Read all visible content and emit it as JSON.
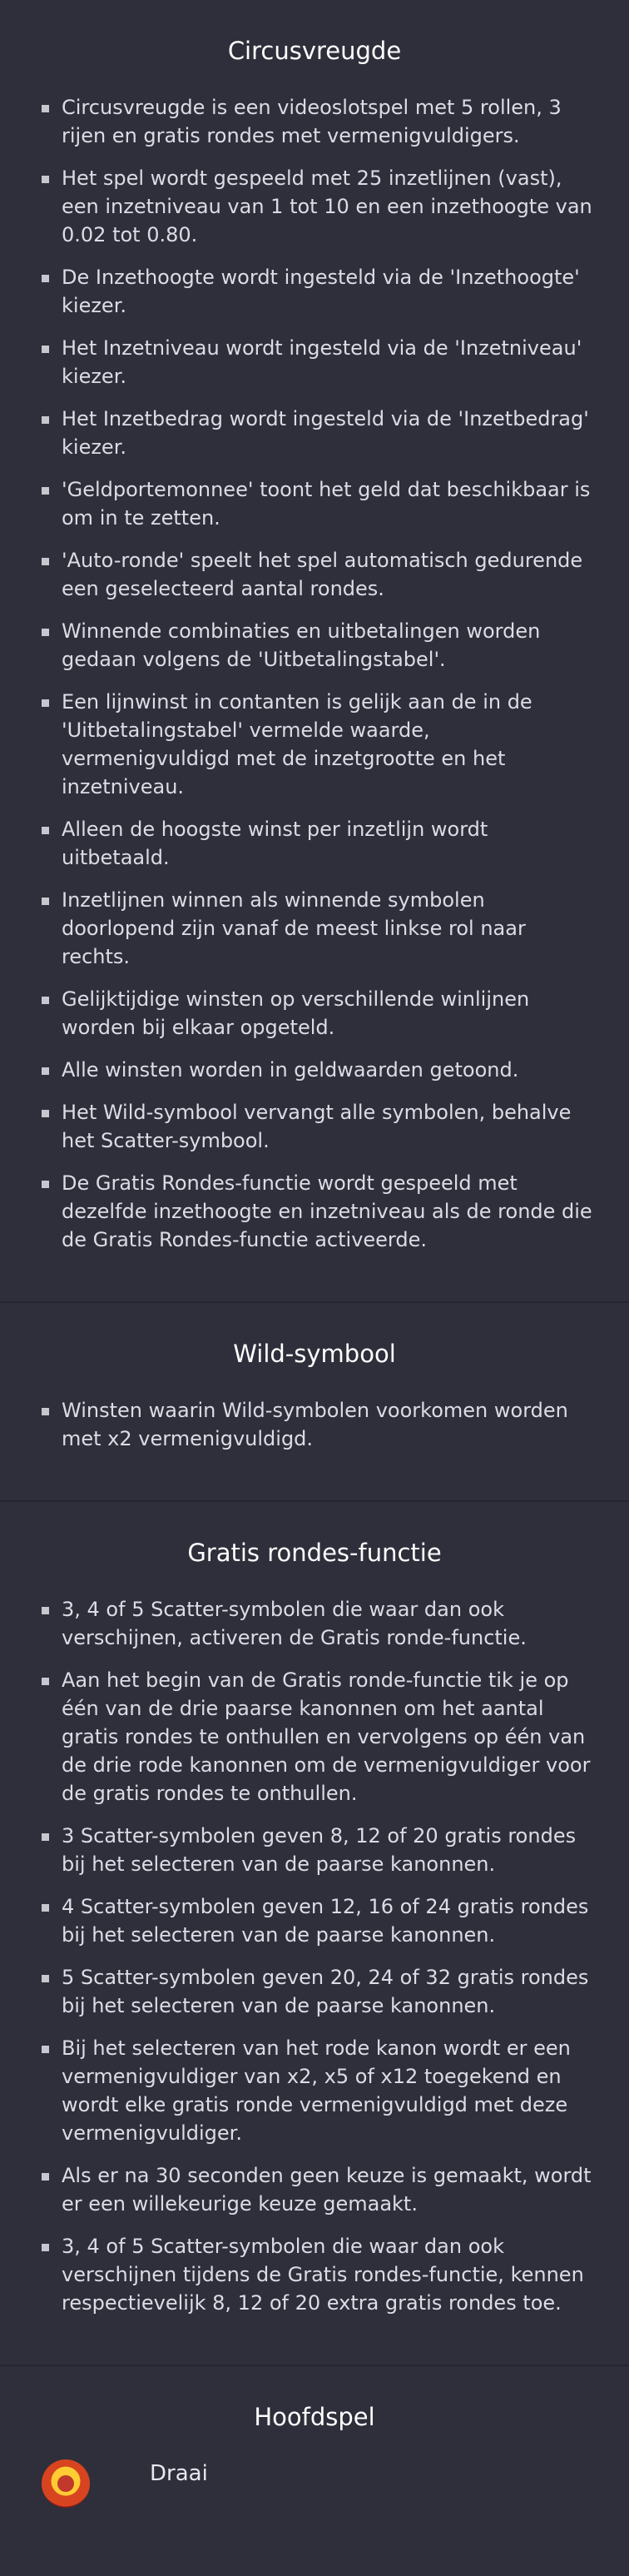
{
  "sections": [
    {
      "title": "Circusvreugde",
      "items": [
        "Circusvreugde is een videoslotspel met 5 rollen, 3 rijen en gratis rondes met vermenigvuldigers.",
        "Het spel wordt gespeeld met 25 inzetlijnen (vast), een inzetniveau van 1 tot 10 en een inzethoogte van 0.02 tot 0.80.",
        "De Inzethoogte wordt ingesteld via de 'Inzethoogte' kiezer.",
        "Het Inzetniveau wordt ingesteld via de 'Inzetniveau' kiezer.",
        "Het Inzetbedrag wordt ingesteld via de 'Inzetbedrag' kiezer.",
        "'Geldportemonnee' toont het geld dat beschikbaar is om in te zetten.",
        "'Auto-ronde' speelt het spel automatisch gedurende een geselecteerd aantal rondes.",
        "Winnende combinaties en uitbetalingen worden gedaan volgens de 'Uitbetalingstabel'.",
        "Een lijnwinst in contanten is gelijk aan de in de 'Uitbetalingstabel' vermelde waarde, vermenigvuldigd met de inzetgrootte en het inzetniveau.",
        "Alleen de hoogste winst per inzetlijn wordt uitbetaald.",
        "Inzetlijnen winnen als winnende symbolen doorlopend zijn vanaf de meest linkse rol naar rechts.",
        "Gelijktijdige winsten op verschillende winlijnen worden bij elkaar opgeteld.",
        "Alle winsten worden in geldwaarden getoond.",
        "Het Wild-symbool vervangt alle symbolen, behalve het Scatter-symbool.",
        "De Gratis Rondes-functie wordt gespeeld met dezelfde inzethoogte en inzetniveau als de ronde die de Gratis Rondes-functie activeerde."
      ]
    },
    {
      "title": "Wild-symbool",
      "items": [
        "Winsten waarin Wild-symbolen voorkomen worden met x2 vermenigvuldigd."
      ]
    },
    {
      "title": "Gratis rondes-functie",
      "items": [
        "3, 4 of 5 Scatter-symbolen die waar dan ook verschijnen, activeren de Gratis ronde-functie.",
        "Aan het begin van de Gratis ronde-functie tik je op één van de drie paarse kanonnen om het aantal gratis rondes te onthullen en vervolgens op één van de drie rode kanonnen om de vermenigvuldiger voor de gratis rondes te onthullen.",
        "3 Scatter-symbolen geven 8, 12 of 20 gratis rondes bij het selecteren van de paarse kanonnen.",
        "4 Scatter-symbolen geven 12, 16 of 24 gratis rondes bij het selecteren van de paarse kanonnen.",
        "5 Scatter-symbolen geven 20, 24 of 32 gratis rondes bij het selecteren van de paarse kanonnen.",
        "Bij het selecteren van het rode kanon wordt er een vermenigvuldiger van x2, x5 of x12 toegekend en wordt elke gratis ronde vermenigvuldigd met deze vermenigvuldiger.",
        "Als er na 30 seconden geen keuze is gemaakt, wordt er een willekeurige keuze gemaakt.",
        "3, 4 of 5 Scatter-symbolen die waar dan ook verschijnen tijdens de Gratis rondes-functie, kennen respectievelijk 8, 12 of 20 extra gratis rondes toe."
      ]
    },
    {
      "title": "Hoofdspel",
      "feature": {
        "icon": "spin-button-icon",
        "label": "Draai"
      }
    }
  ]
}
